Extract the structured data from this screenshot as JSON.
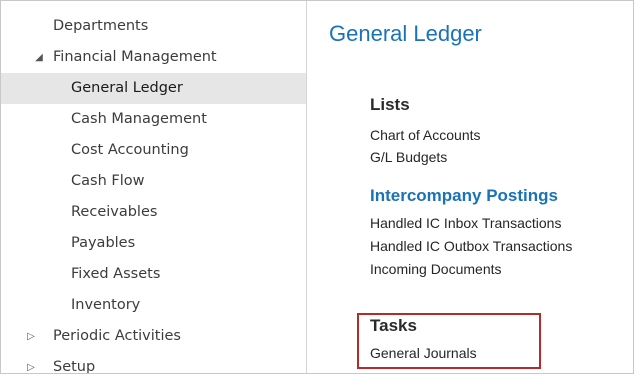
{
  "nav": {
    "items": [
      {
        "label": "Departments",
        "arrow": ""
      },
      {
        "label": "Financial Management",
        "arrow": "◢"
      },
      {
        "label": "General Ledger",
        "arrow": ""
      },
      {
        "label": "Cash Management",
        "arrow": ""
      },
      {
        "label": "Cost Accounting",
        "arrow": ""
      },
      {
        "label": "Cash Flow",
        "arrow": ""
      },
      {
        "label": "Receivables",
        "arrow": ""
      },
      {
        "label": "Payables",
        "arrow": ""
      },
      {
        "label": "Fixed Assets",
        "arrow": ""
      },
      {
        "label": "Inventory",
        "arrow": ""
      },
      {
        "label": "Periodic Activities",
        "arrow": "▷"
      },
      {
        "label": "Setup",
        "arrow": "▷"
      }
    ],
    "selected": "General Ledger"
  },
  "main": {
    "title": "General Ledger",
    "lists_title": "Lists",
    "lists": [
      "Chart of Accounts",
      "G/L Budgets"
    ],
    "intercompany_title": "Intercompany Postings",
    "intercompany": [
      "Handled IC Inbox Transactions",
      "Handled IC Outbox Transactions",
      "Incoming Documents"
    ],
    "tasks_title": "Tasks",
    "tasks": [
      "General Journals"
    ]
  },
  "colors": {
    "accent": "#1a73b7",
    "selection": "#e6e6e6",
    "highlight_border": "#b52b2b"
  }
}
